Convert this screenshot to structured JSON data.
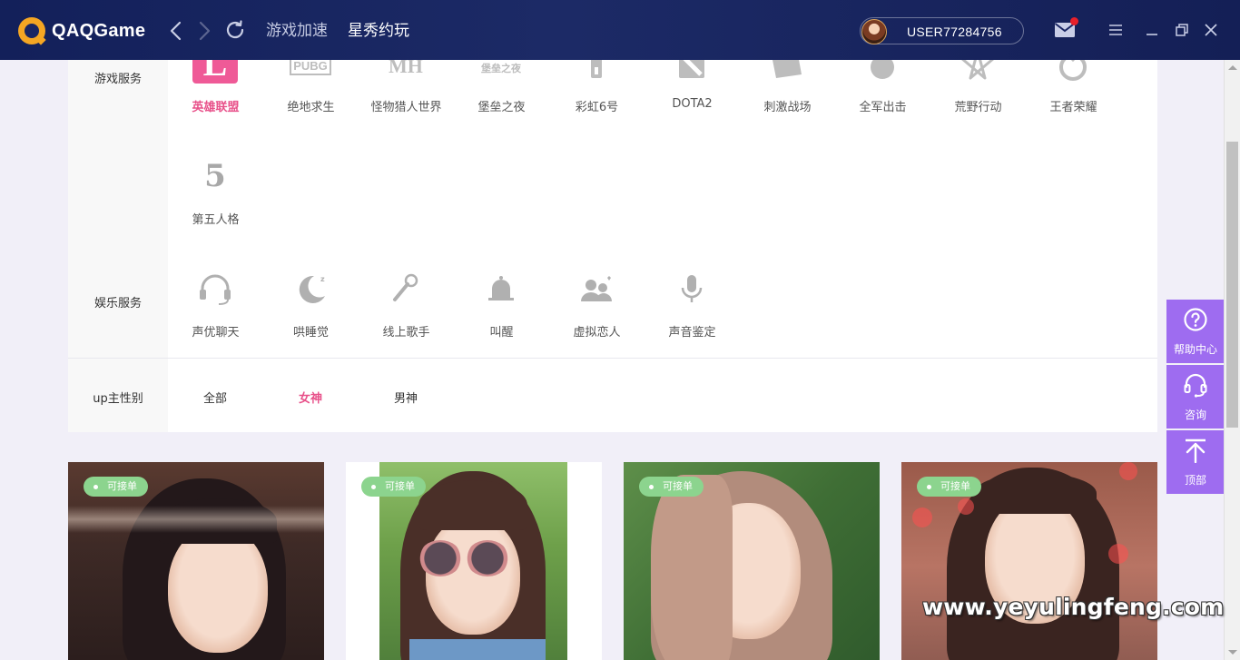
{
  "app": {
    "name": "QAQGame",
    "username": "USER77284756"
  },
  "nav": {
    "accelerate": "游戏加速",
    "play": "星秀约玩"
  },
  "filters": {
    "game_label": "游戏服务",
    "games": [
      {
        "name": "英雄联盟",
        "icon": "lol-icon",
        "active": true
      },
      {
        "name": "绝地求生",
        "icon": "pubg-icon",
        "logo_text": "PUBG"
      },
      {
        "name": "怪物猎人世界",
        "icon": "monster-hunter-icon",
        "logo_text": "MH"
      },
      {
        "name": "堡垒之夜",
        "icon": "fortnite-icon",
        "logo_text": "堡垒之夜"
      },
      {
        "name": "彩虹6号",
        "icon": "rainbow-six-icon"
      },
      {
        "name": "DOTA2",
        "icon": "dota2-icon"
      },
      {
        "name": "刺激战场",
        "icon": "battleground-icon"
      },
      {
        "name": "全军出击",
        "icon": "full-assault-icon"
      },
      {
        "name": "荒野行动",
        "icon": "knives-out-icon"
      },
      {
        "name": "王者荣耀",
        "icon": "honor-of-kings-icon"
      },
      {
        "name": "第五人格",
        "icon": "identity-v-icon",
        "logo_text": "5"
      }
    ],
    "ent_label": "娱乐服务",
    "entertainment": [
      {
        "name": "声优聊天",
        "icon": "headset-icon"
      },
      {
        "name": "哄睡觉",
        "icon": "moon-sleep-icon"
      },
      {
        "name": "线上歌手",
        "icon": "microphone-icon"
      },
      {
        "name": "叫醒",
        "icon": "bell-icon"
      },
      {
        "name": "虚拟恋人",
        "icon": "couple-icon"
      },
      {
        "name": "声音鉴定",
        "icon": "voice-mic-icon"
      }
    ],
    "gender_label": "up主性别",
    "genders": [
      {
        "name": "全部"
      },
      {
        "name": "女神",
        "active": true
      },
      {
        "name": "男神"
      }
    ]
  },
  "cards": [
    {
      "badge": "可接单"
    },
    {
      "badge": "可接单"
    },
    {
      "badge": "可接单"
    },
    {
      "badge": "可接单"
    }
  ],
  "side": {
    "help": "帮助中心",
    "consult": "咨询",
    "top": "顶部"
  },
  "watermark": "www.yeyulingfeng.com",
  "colors": {
    "accent_pink": "#e8518a",
    "side_purple": "#9e6cf0",
    "badge_green": "#8cd48e",
    "titlebar": "#1a2663"
  }
}
